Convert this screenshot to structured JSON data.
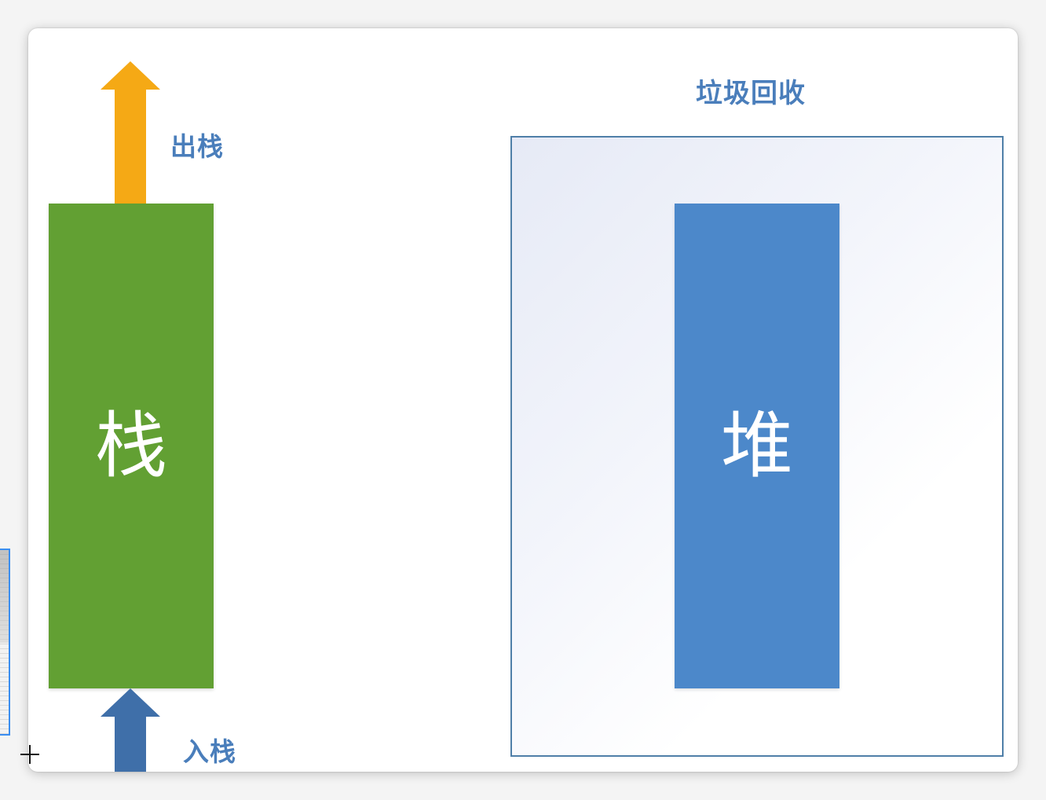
{
  "stack": {
    "label": "栈",
    "color": "#62a033",
    "pop_label": "出栈",
    "pop_arrow_color": "#f5a915",
    "push_label": "入栈",
    "push_arrow_color": "#3f6fa9"
  },
  "heap": {
    "label": "堆",
    "color": "#4c88ca",
    "gc_title": "垃圾回收",
    "gc_border_color": "#4f7fa8"
  },
  "text_color": "#4a7ebb"
}
